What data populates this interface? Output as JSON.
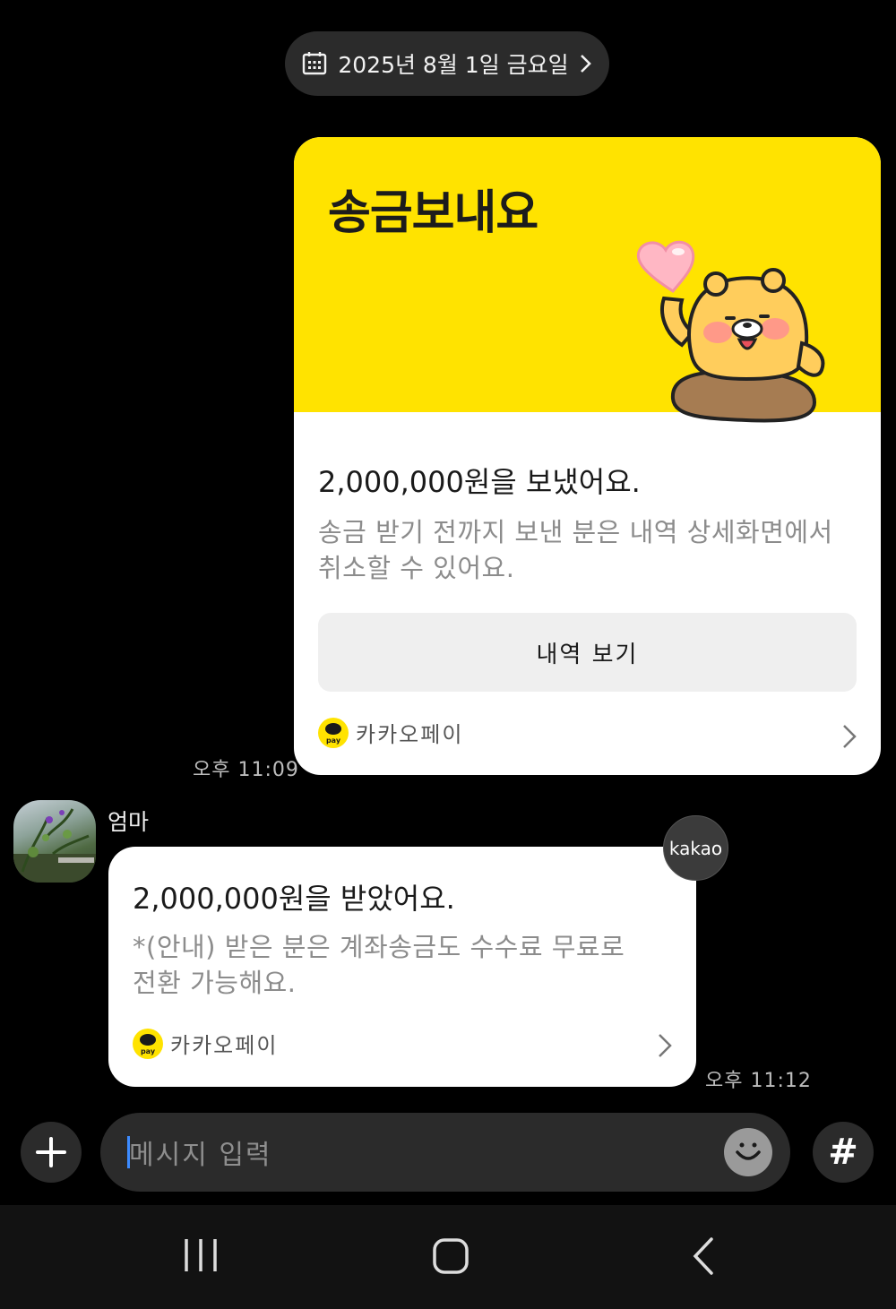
{
  "date_pill": {
    "text": "2025년 8월 1일 금요일"
  },
  "sent_message": {
    "banner_title": "송금보내요",
    "main_text": "2,000,000원을 보냈어요.",
    "sub_line1": "송금 받기 전까지 보낸 분은 내역 상세화면에서",
    "sub_line2": "취소할 수 있어요.",
    "button_label": "내역 보기",
    "footer_label": "카카오페이",
    "time": "오후 11:09"
  },
  "received_message": {
    "sender": "엄마",
    "badge": "kakao",
    "main_text": "2,000,000원을 받았어요.",
    "sub_line1": "*(안내) 받은 분은 계좌송금도 수수료 무료로",
    "sub_line2": "전환 가능해요.",
    "footer_label": "카카오페이",
    "time": "오후 11:12"
  },
  "pay_logo_text": "pay",
  "input_bar": {
    "placeholder": "메시지 입력",
    "hash_label": "#"
  },
  "colors": {
    "kakao_yellow": "#ffe300",
    "background": "#000000",
    "bubble_dark": "#2b2b2b"
  },
  "icons": {
    "date": "calendar-icon",
    "plus": "plus-icon",
    "emoji": "smile-icon",
    "nav_recent": "recent-apps-icon",
    "nav_home": "home-icon",
    "nav_back": "back-icon"
  }
}
